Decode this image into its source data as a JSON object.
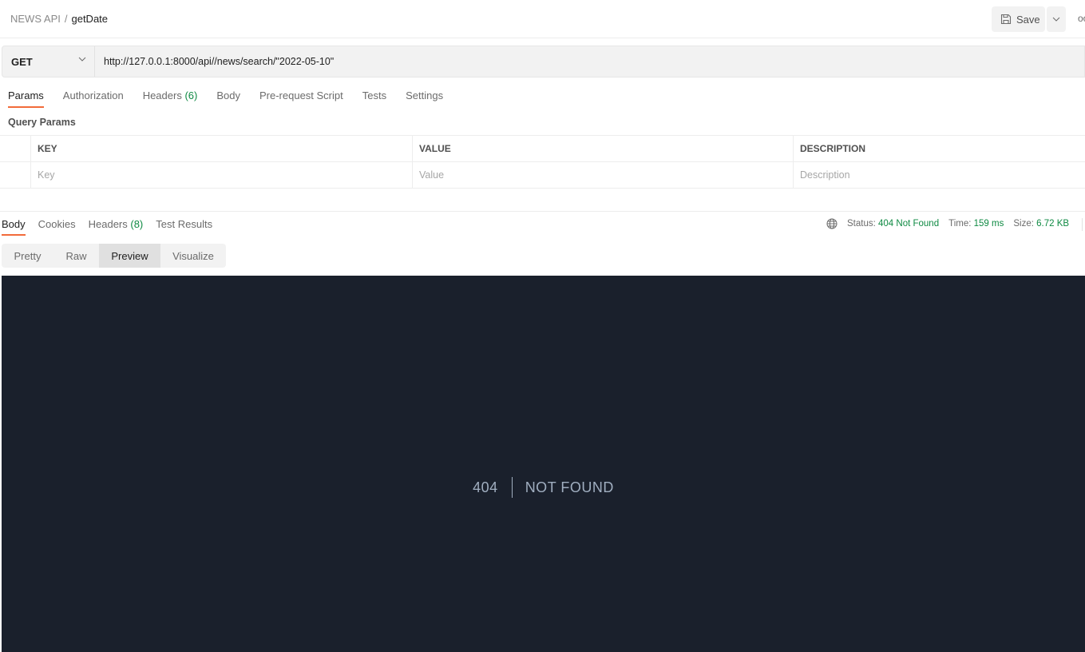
{
  "header": {
    "collection": "NEWS API",
    "separator": "/",
    "request_name": "getDate",
    "save_label": "Save",
    "more_label": "oo"
  },
  "request": {
    "method": "GET",
    "url": "http://127.0.0.1:8000/api//news/search/\"2022-05-10\""
  },
  "request_tabs": [
    {
      "label": "Params",
      "count": null,
      "active": true
    },
    {
      "label": "Authorization",
      "count": null,
      "active": false
    },
    {
      "label": "Headers",
      "count": "(6)",
      "active": false
    },
    {
      "label": "Body",
      "count": null,
      "active": false
    },
    {
      "label": "Pre-request Script",
      "count": null,
      "active": false
    },
    {
      "label": "Tests",
      "count": null,
      "active": false
    },
    {
      "label": "Settings",
      "count": null,
      "active": false
    }
  ],
  "query_params": {
    "title": "Query Params",
    "columns": [
      "KEY",
      "VALUE",
      "DESCRIPTION"
    ],
    "placeholders": {
      "key": "Key",
      "value": "Value",
      "description": "Description"
    }
  },
  "response_tabs": [
    {
      "label": "Body",
      "count": null,
      "active": true
    },
    {
      "label": "Cookies",
      "count": null,
      "active": false
    },
    {
      "label": "Headers",
      "count": "(8)",
      "active": false
    },
    {
      "label": "Test Results",
      "count": null,
      "active": false
    }
  ],
  "response_meta": {
    "status_label": "Status:",
    "status_value": "404 Not Found",
    "time_label": "Time:",
    "time_value": "159 ms",
    "size_label": "Size:",
    "size_value": "6.72 KB"
  },
  "view_tabs": [
    {
      "label": "Pretty",
      "active": false
    },
    {
      "label": "Raw",
      "active": false
    },
    {
      "label": "Preview",
      "active": true
    },
    {
      "label": "Visualize",
      "active": false
    }
  ],
  "preview": {
    "code": "404",
    "message": "Not Found"
  },
  "colors": {
    "accent": "#f26b3a",
    "status_green": "#0f8a43",
    "preview_bg": "#1a202c",
    "preview_text": "#a0aec0"
  }
}
